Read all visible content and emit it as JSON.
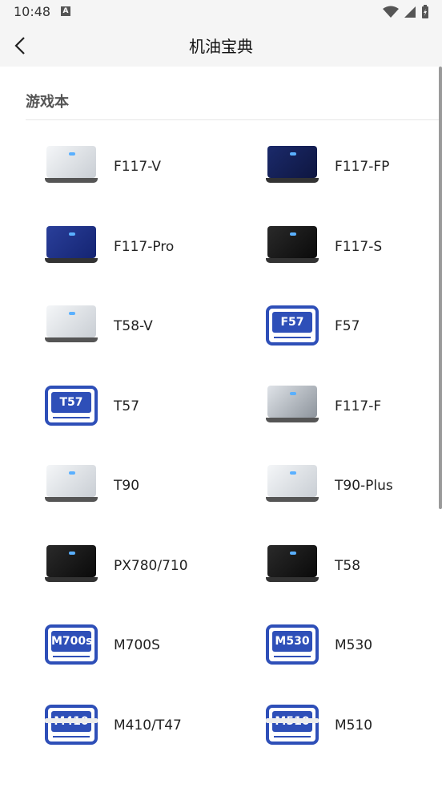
{
  "status": {
    "time": "10:48",
    "notif": "A"
  },
  "header": {
    "title": "机油宝典"
  },
  "section": {
    "title": "游戏本"
  },
  "items": [
    {
      "label": "F117-V",
      "thumb": "silver"
    },
    {
      "label": "F117-FP",
      "thumb": "navy"
    },
    {
      "label": "F117-Pro",
      "thumb": "blue"
    },
    {
      "label": "F117-S",
      "thumb": "black"
    },
    {
      "label": "T58-V",
      "thumb": "silver"
    },
    {
      "label": "F57",
      "thumb": "badge",
      "badge_text": "F57"
    },
    {
      "label": "T57",
      "thumb": "badge",
      "badge_text": "T57"
    },
    {
      "label": "F117-F",
      "thumb": "open"
    },
    {
      "label": "T90",
      "thumb": "silver"
    },
    {
      "label": "T90-Plus",
      "thumb": "silver"
    },
    {
      "label": "PX780/710",
      "thumb": "black"
    },
    {
      "label": "T58",
      "thumb": "black"
    },
    {
      "label": "M700S",
      "thumb": "badge",
      "badge_text": "M700s"
    },
    {
      "label": "M530",
      "thumb": "badge",
      "badge_text": "M530"
    },
    {
      "label": "M410/T47",
      "thumb": "badge",
      "badge_text": "M410"
    },
    {
      "label": "M510",
      "thumb": "badge",
      "badge_text": "M510"
    }
  ],
  "colors": {
    "badge_blue": "#2e4fb8",
    "header_bg": "#f5f5f5"
  }
}
